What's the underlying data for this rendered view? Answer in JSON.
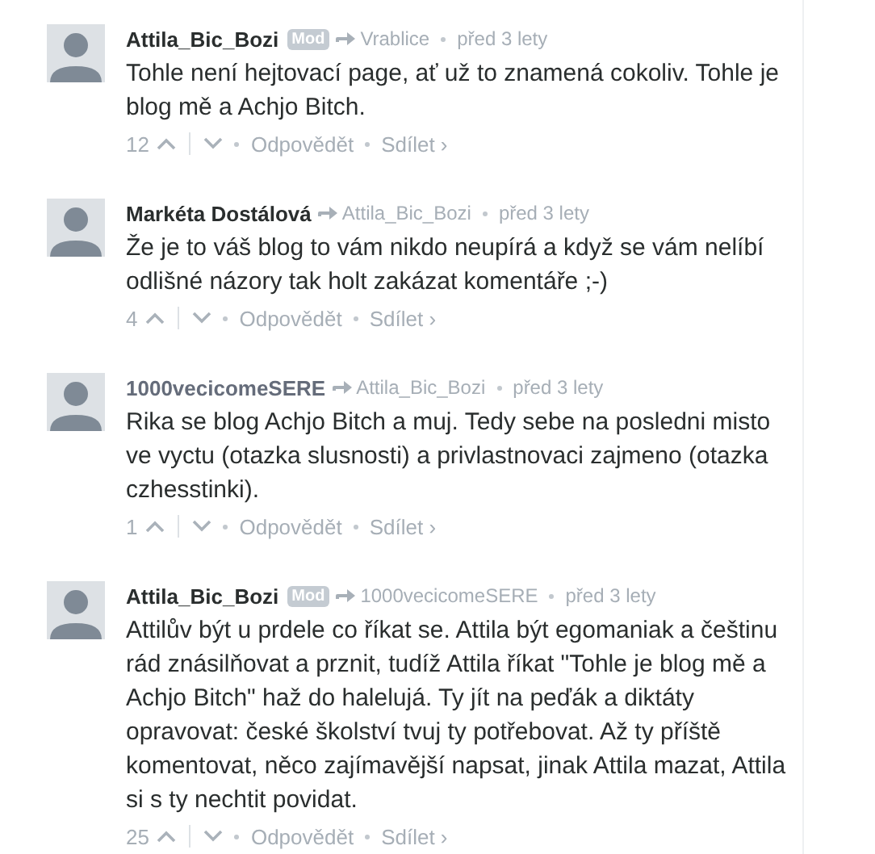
{
  "comments": [
    {
      "author": "Attila_Bic_Bozi",
      "author_guest": false,
      "badge": "Mod",
      "reply_to": "Vrablice",
      "time": "před 3 lety",
      "text": "Tohle není hejtovací page, ať už to znamená cokoliv. Tohle je blog mě a Achjo Bitch.",
      "votes": "12",
      "reply": "Odpovědět",
      "share": "Sdílet ›"
    },
    {
      "author": "Markéta Dostálová",
      "author_guest": false,
      "reply_to": "Attila_Bic_Bozi",
      "time": "před 3 lety",
      "text": "Že je to váš blog to vám nikdo neupírá a když se vám nelíbí odlišné názory tak holt zakázat komentáře ;-)",
      "votes": "4",
      "reply": "Odpovědět",
      "share": "Sdílet ›"
    },
    {
      "author": "1000vecicomeSERE",
      "author_guest": true,
      "reply_to": "Attila_Bic_Bozi",
      "time": "před 3 lety",
      "text": "Rika se blog Achjo Bitch a muj. Tedy sebe na posledni misto ve vyctu (otazka slusnosti) a privlastnovaci zajmeno (otazka czhesstinki).",
      "votes": "1",
      "reply": "Odpovědět",
      "share": "Sdílet ›"
    },
    {
      "author": "Attila_Bic_Bozi",
      "author_guest": false,
      "badge": "Mod",
      "reply_to": "1000vecicomeSERE",
      "time": "před 3 lety",
      "text": "Attilův být u prdele co říkat se. Attila být egomaniak a češtinu rád znásilňovat a prznit, tudíž Attila říkat \"Tohle je blog mě a Achjo Bitch\" haž do halelujá. Ty jít na peďák a diktáty opravovat: české školství tvuj ty potřebovat. Až ty příště komentovat, něco zajímavější napsat, jinak Attila mazat, Attila si s ty nechtit povidat.",
      "votes": "25",
      "reply": "Odpovědět",
      "share": "Sdílet ›"
    }
  ]
}
